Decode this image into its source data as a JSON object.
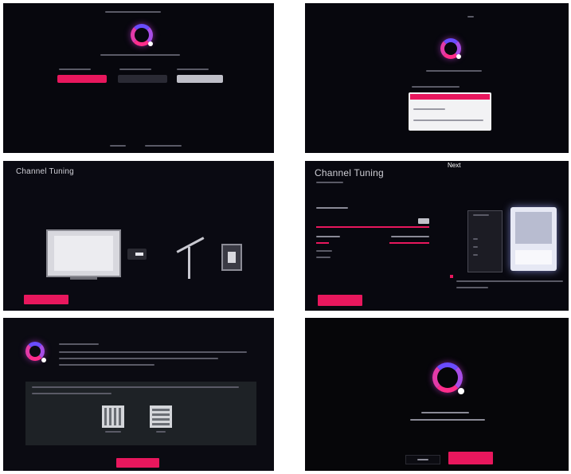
{
  "screens": {
    "channel_tuning_title": "Channel Tuning",
    "next_label": "Next"
  },
  "colors": {
    "accent": "#e8175d",
    "ring_purple": "#6a4cff",
    "ring_pink": "#ff2d8c",
    "background": "#07070d"
  },
  "icons": {
    "assistant_ring": "ring-icon",
    "qr": "qr-code-icon",
    "tv": "tv-icon",
    "antenna": "antenna-icon",
    "cable_box": "cable-box-icon"
  }
}
